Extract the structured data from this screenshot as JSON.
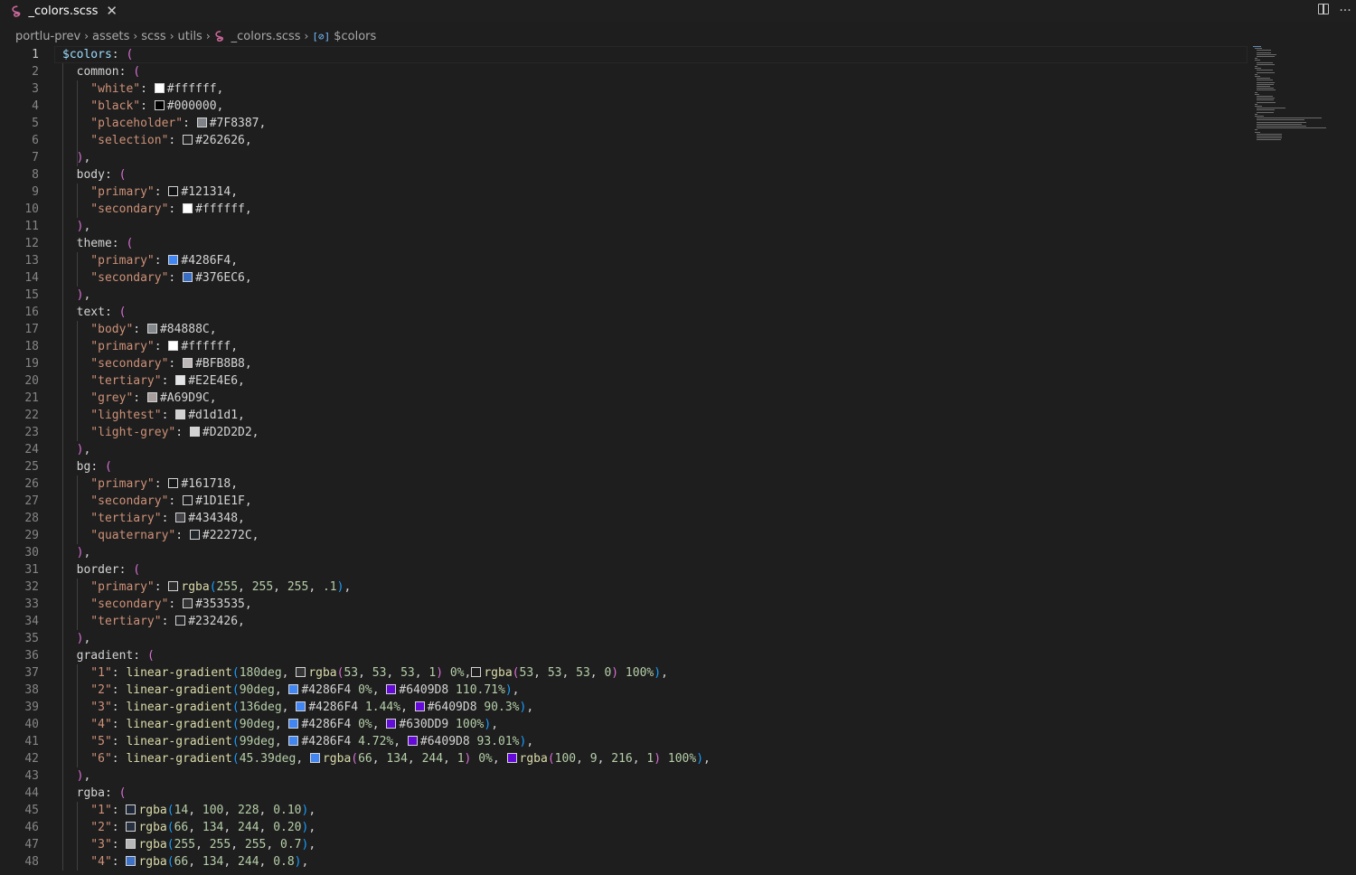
{
  "tab": {
    "title": "_colors.scss",
    "close": "✕"
  },
  "top_actions": {
    "more": "···"
  },
  "breadcrumb": [
    "portlu-prev",
    "assets",
    "scss",
    "utils",
    "_colors.scss",
    "$colors"
  ],
  "breadcrumb_sep": "›",
  "symbol_glyph": "[⊘]",
  "current_line": 1,
  "lines": [
    [
      {
        "t": "$colors",
        "c": "var"
      },
      {
        "t": ": ",
        "c": "p"
      },
      {
        "t": "(",
        "c": "brace"
      }
    ],
    [
      {
        "t": "  common",
        "c": "key"
      },
      {
        "t": ": ",
        "c": "p"
      },
      {
        "t": "(",
        "c": "brace"
      }
    ],
    [
      {
        "t": "    \"white\"",
        "c": "str"
      },
      {
        "t": ": ",
        "c": "p"
      },
      {
        "sw": "#ffffff"
      },
      {
        "t": "#ffffff,",
        "c": "p"
      }
    ],
    [
      {
        "t": "    \"black\"",
        "c": "str"
      },
      {
        "t": ": ",
        "c": "p"
      },
      {
        "sw": "#000000"
      },
      {
        "t": "#000000,",
        "c": "p"
      }
    ],
    [
      {
        "t": "    \"placeholder\"",
        "c": "str"
      },
      {
        "t": ": ",
        "c": "p"
      },
      {
        "sw": "#7F8387"
      },
      {
        "t": "#7F8387,",
        "c": "p"
      }
    ],
    [
      {
        "t": "    \"selection\"",
        "c": "str"
      },
      {
        "t": ": ",
        "c": "p"
      },
      {
        "sw": "#262626"
      },
      {
        "t": "#262626,",
        "c": "p"
      }
    ],
    [
      {
        "t": "  ",
        "c": "p"
      },
      {
        "t": ")",
        "c": "brace"
      },
      {
        "t": ",",
        "c": "p"
      }
    ],
    [
      {
        "t": "  body",
        "c": "key"
      },
      {
        "t": ": ",
        "c": "p"
      },
      {
        "t": "(",
        "c": "brace"
      }
    ],
    [
      {
        "t": "    \"primary\"",
        "c": "str"
      },
      {
        "t": ": ",
        "c": "p"
      },
      {
        "sw": "#121314"
      },
      {
        "t": "#121314,",
        "c": "p"
      }
    ],
    [
      {
        "t": "    \"secondary\"",
        "c": "str"
      },
      {
        "t": ": ",
        "c": "p"
      },
      {
        "sw": "#ffffff"
      },
      {
        "t": "#ffffff,",
        "c": "p"
      }
    ],
    [
      {
        "t": "  ",
        "c": "p"
      },
      {
        "t": ")",
        "c": "brace"
      },
      {
        "t": ",",
        "c": "p"
      }
    ],
    [
      {
        "t": "  theme",
        "c": "key"
      },
      {
        "t": ": ",
        "c": "p"
      },
      {
        "t": "(",
        "c": "brace"
      }
    ],
    [
      {
        "t": "    \"primary\"",
        "c": "str"
      },
      {
        "t": ": ",
        "c": "p"
      },
      {
        "sw": "#4286F4"
      },
      {
        "t": "#4286F4,",
        "c": "p"
      }
    ],
    [
      {
        "t": "    \"secondary\"",
        "c": "str"
      },
      {
        "t": ": ",
        "c": "p"
      },
      {
        "sw": "#376EC6"
      },
      {
        "t": "#376EC6,",
        "c": "p"
      }
    ],
    [
      {
        "t": "  ",
        "c": "p"
      },
      {
        "t": ")",
        "c": "brace"
      },
      {
        "t": ",",
        "c": "p"
      }
    ],
    [
      {
        "t": "  text",
        "c": "key"
      },
      {
        "t": ": ",
        "c": "p"
      },
      {
        "t": "(",
        "c": "brace"
      }
    ],
    [
      {
        "t": "    \"body\"",
        "c": "str"
      },
      {
        "t": ": ",
        "c": "p"
      },
      {
        "sw": "#84888C"
      },
      {
        "t": "#84888C,",
        "c": "p"
      }
    ],
    [
      {
        "t": "    \"primary\"",
        "c": "str"
      },
      {
        "t": ": ",
        "c": "p"
      },
      {
        "sw": "#ffffff"
      },
      {
        "t": "#ffffff,",
        "c": "p"
      }
    ],
    [
      {
        "t": "    \"secondary\"",
        "c": "str"
      },
      {
        "t": ": ",
        "c": "p"
      },
      {
        "sw": "#BFB8B8"
      },
      {
        "t": "#BFB8B8,",
        "c": "p"
      }
    ],
    [
      {
        "t": "    \"tertiary\"",
        "c": "str"
      },
      {
        "t": ": ",
        "c": "p"
      },
      {
        "sw": "#E2E4E6"
      },
      {
        "t": "#E2E4E6,",
        "c": "p"
      }
    ],
    [
      {
        "t": "    \"grey\"",
        "c": "str"
      },
      {
        "t": ": ",
        "c": "p"
      },
      {
        "sw": "#A69D9C"
      },
      {
        "t": "#A69D9C,",
        "c": "p"
      }
    ],
    [
      {
        "t": "    \"lightest\"",
        "c": "str"
      },
      {
        "t": ": ",
        "c": "p"
      },
      {
        "sw": "#d1d1d1"
      },
      {
        "t": "#d1d1d1,",
        "c": "p"
      }
    ],
    [
      {
        "t": "    \"light-grey\"",
        "c": "str"
      },
      {
        "t": ": ",
        "c": "p"
      },
      {
        "sw": "#D2D2D2"
      },
      {
        "t": "#D2D2D2,",
        "c": "p"
      }
    ],
    [
      {
        "t": "  ",
        "c": "p"
      },
      {
        "t": ")",
        "c": "brace"
      },
      {
        "t": ",",
        "c": "p"
      }
    ],
    [
      {
        "t": "  bg",
        "c": "key"
      },
      {
        "t": ": ",
        "c": "p"
      },
      {
        "t": "(",
        "c": "brace"
      }
    ],
    [
      {
        "t": "    \"primary\"",
        "c": "str"
      },
      {
        "t": ": ",
        "c": "p"
      },
      {
        "sw": "#161718"
      },
      {
        "t": "#161718,",
        "c": "p"
      }
    ],
    [
      {
        "t": "    \"secondary\"",
        "c": "str"
      },
      {
        "t": ": ",
        "c": "p"
      },
      {
        "sw": "#1D1E1F"
      },
      {
        "t": "#1D1E1F,",
        "c": "p"
      }
    ],
    [
      {
        "t": "    \"tertiary\"",
        "c": "str"
      },
      {
        "t": ": ",
        "c": "p"
      },
      {
        "sw": "#434348"
      },
      {
        "t": "#434348,",
        "c": "p"
      }
    ],
    [
      {
        "t": "    \"quaternary\"",
        "c": "str"
      },
      {
        "t": ": ",
        "c": "p"
      },
      {
        "sw": "#22272C"
      },
      {
        "t": "#22272C,",
        "c": "p"
      }
    ],
    [
      {
        "t": "  ",
        "c": "p"
      },
      {
        "t": ")",
        "c": "brace"
      },
      {
        "t": ",",
        "c": "p"
      }
    ],
    [
      {
        "t": "  border",
        "c": "key"
      },
      {
        "t": ": ",
        "c": "p"
      },
      {
        "t": "(",
        "c": "brace"
      }
    ],
    [
      {
        "t": "    \"primary\"",
        "c": "str"
      },
      {
        "t": ": ",
        "c": "p"
      },
      {
        "sw": "#2b2b2b"
      },
      {
        "t": "rgba",
        "c": "fn"
      },
      {
        "t": "(",
        "c": "paren"
      },
      {
        "t": "255",
        "c": "num"
      },
      {
        "t": ", ",
        "c": "p"
      },
      {
        "t": "255",
        "c": "num"
      },
      {
        "t": ", ",
        "c": "p"
      },
      {
        "t": "255",
        "c": "num"
      },
      {
        "t": ", ",
        "c": "p"
      },
      {
        "t": ".1",
        "c": "num"
      },
      {
        "t": ")",
        "c": "paren"
      },
      {
        "t": ",",
        "c": "p"
      }
    ],
    [
      {
        "t": "    \"secondary\"",
        "c": "str"
      },
      {
        "t": ": ",
        "c": "p"
      },
      {
        "sw": "#353535"
      },
      {
        "t": "#353535,",
        "c": "p"
      }
    ],
    [
      {
        "t": "    \"tertiary\"",
        "c": "str"
      },
      {
        "t": ": ",
        "c": "p"
      },
      {
        "sw": "#232426"
      },
      {
        "t": "#232426,",
        "c": "p"
      }
    ],
    [
      {
        "t": "  ",
        "c": "p"
      },
      {
        "t": ")",
        "c": "brace"
      },
      {
        "t": ",",
        "c": "p"
      }
    ],
    [
      {
        "t": "  gradient",
        "c": "key"
      },
      {
        "t": ": ",
        "c": "p"
      },
      {
        "t": "(",
        "c": "brace"
      }
    ],
    [
      {
        "t": "    \"1\"",
        "c": "str"
      },
      {
        "t": ": ",
        "c": "p"
      },
      {
        "t": "linear-gradient",
        "c": "fn"
      },
      {
        "t": "(",
        "c": "paren"
      },
      {
        "t": "180deg",
        "c": "num"
      },
      {
        "t": ", ",
        "c": "p"
      },
      {
        "sw": "#353535"
      },
      {
        "t": "rgba",
        "c": "fn"
      },
      {
        "t": "(",
        "c": "brace"
      },
      {
        "t": "53",
        "c": "num"
      },
      {
        "t": ", ",
        "c": "p"
      },
      {
        "t": "53",
        "c": "num"
      },
      {
        "t": ", ",
        "c": "p"
      },
      {
        "t": "53",
        "c": "num"
      },
      {
        "t": ", ",
        "c": "p"
      },
      {
        "t": "1",
        "c": "num"
      },
      {
        "t": ")",
        "c": "brace"
      },
      {
        "t": " ",
        "c": "p"
      },
      {
        "t": "0%",
        "c": "num"
      },
      {
        "t": ",",
        "c": "p"
      },
      {
        "sw": "#1e1e1e"
      },
      {
        "t": "rgba",
        "c": "fn"
      },
      {
        "t": "(",
        "c": "brace"
      },
      {
        "t": "53",
        "c": "num"
      },
      {
        "t": ", ",
        "c": "p"
      },
      {
        "t": "53",
        "c": "num"
      },
      {
        "t": ", ",
        "c": "p"
      },
      {
        "t": "53",
        "c": "num"
      },
      {
        "t": ", ",
        "c": "p"
      },
      {
        "t": "0",
        "c": "num"
      },
      {
        "t": ")",
        "c": "brace"
      },
      {
        "t": " ",
        "c": "p"
      },
      {
        "t": "100%",
        "c": "num"
      },
      {
        "t": ")",
        "c": "paren"
      },
      {
        "t": ",",
        "c": "p"
      }
    ],
    [
      {
        "t": "    \"2\"",
        "c": "str"
      },
      {
        "t": ": ",
        "c": "p"
      },
      {
        "t": "linear-gradient",
        "c": "fn"
      },
      {
        "t": "(",
        "c": "paren"
      },
      {
        "t": "90deg",
        "c": "num"
      },
      {
        "t": ", ",
        "c": "p"
      },
      {
        "sw": "#4286F4"
      },
      {
        "t": "#4286F4 ",
        "c": "p"
      },
      {
        "t": "0%",
        "c": "num"
      },
      {
        "t": ", ",
        "c": "p"
      },
      {
        "sw": "#6409D8"
      },
      {
        "t": "#6409D8 ",
        "c": "p"
      },
      {
        "t": "110.71%",
        "c": "num"
      },
      {
        "t": ")",
        "c": "paren"
      },
      {
        "t": ",",
        "c": "p"
      }
    ],
    [
      {
        "t": "    \"3\"",
        "c": "str"
      },
      {
        "t": ": ",
        "c": "p"
      },
      {
        "t": "linear-gradient",
        "c": "fn"
      },
      {
        "t": "(",
        "c": "paren"
      },
      {
        "t": "136deg",
        "c": "num"
      },
      {
        "t": ", ",
        "c": "p"
      },
      {
        "sw": "#4286F4"
      },
      {
        "t": "#4286F4 ",
        "c": "p"
      },
      {
        "t": "1.44%",
        "c": "num"
      },
      {
        "t": ", ",
        "c": "p"
      },
      {
        "sw": "#6409D8"
      },
      {
        "t": "#6409D8 ",
        "c": "p"
      },
      {
        "t": "90.3%",
        "c": "num"
      },
      {
        "t": ")",
        "c": "paren"
      },
      {
        "t": ",",
        "c": "p"
      }
    ],
    [
      {
        "t": "    \"4\"",
        "c": "str"
      },
      {
        "t": ": ",
        "c": "p"
      },
      {
        "t": "linear-gradient",
        "c": "fn"
      },
      {
        "t": "(",
        "c": "paren"
      },
      {
        "t": "90deg",
        "c": "num"
      },
      {
        "t": ", ",
        "c": "p"
      },
      {
        "sw": "#4286F4"
      },
      {
        "t": "#4286F4 ",
        "c": "p"
      },
      {
        "t": "0%",
        "c": "num"
      },
      {
        "t": ", ",
        "c": "p"
      },
      {
        "sw": "#630DD9"
      },
      {
        "t": "#630DD9 ",
        "c": "p"
      },
      {
        "t": "100%",
        "c": "num"
      },
      {
        "t": ")",
        "c": "paren"
      },
      {
        "t": ",",
        "c": "p"
      }
    ],
    [
      {
        "t": "    \"5\"",
        "c": "str"
      },
      {
        "t": ": ",
        "c": "p"
      },
      {
        "t": "linear-gradient",
        "c": "fn"
      },
      {
        "t": "(",
        "c": "paren"
      },
      {
        "t": "99deg",
        "c": "num"
      },
      {
        "t": ", ",
        "c": "p"
      },
      {
        "sw": "#4286F4"
      },
      {
        "t": "#4286F4 ",
        "c": "p"
      },
      {
        "t": "4.72%",
        "c": "num"
      },
      {
        "t": ", ",
        "c": "p"
      },
      {
        "sw": "#6409D8"
      },
      {
        "t": "#6409D8 ",
        "c": "p"
      },
      {
        "t": "93.01%",
        "c": "num"
      },
      {
        "t": ")",
        "c": "paren"
      },
      {
        "t": ",",
        "c": "p"
      }
    ],
    [
      {
        "t": "    \"6\"",
        "c": "str"
      },
      {
        "t": ": ",
        "c": "p"
      },
      {
        "t": "linear-gradient",
        "c": "fn"
      },
      {
        "t": "(",
        "c": "paren"
      },
      {
        "t": "45.39deg",
        "c": "num"
      },
      {
        "t": ", ",
        "c": "p"
      },
      {
        "sw": "#4286F4"
      },
      {
        "t": "rgba",
        "c": "fn"
      },
      {
        "t": "(",
        "c": "brace"
      },
      {
        "t": "66",
        "c": "num"
      },
      {
        "t": ", ",
        "c": "p"
      },
      {
        "t": "134",
        "c": "num"
      },
      {
        "t": ", ",
        "c": "p"
      },
      {
        "t": "244",
        "c": "num"
      },
      {
        "t": ", ",
        "c": "p"
      },
      {
        "t": "1",
        "c": "num"
      },
      {
        "t": ")",
        "c": "brace"
      },
      {
        "t": " ",
        "c": "p"
      },
      {
        "t": "0%",
        "c": "num"
      },
      {
        "t": ", ",
        "c": "p"
      },
      {
        "sw": "#6409D8"
      },
      {
        "t": "rgba",
        "c": "fn"
      },
      {
        "t": "(",
        "c": "brace"
      },
      {
        "t": "100",
        "c": "num"
      },
      {
        "t": ", ",
        "c": "p"
      },
      {
        "t": "9",
        "c": "num"
      },
      {
        "t": ", ",
        "c": "p"
      },
      {
        "t": "216",
        "c": "num"
      },
      {
        "t": ", ",
        "c": "p"
      },
      {
        "t": "1",
        "c": "num"
      },
      {
        "t": ")",
        "c": "brace"
      },
      {
        "t": " ",
        "c": "p"
      },
      {
        "t": "100%",
        "c": "num"
      },
      {
        "t": ")",
        "c": "paren"
      },
      {
        "t": ",",
        "c": "p"
      }
    ],
    [
      {
        "t": "  ",
        "c": "p"
      },
      {
        "t": ")",
        "c": "brace"
      },
      {
        "t": ",",
        "c": "p"
      }
    ],
    [
      {
        "t": "  rgba",
        "c": "key"
      },
      {
        "t": ": ",
        "c": "p"
      },
      {
        "t": "(",
        "c": "brace"
      }
    ],
    [
      {
        "t": "    \"1\"",
        "c": "str"
      },
      {
        "t": ": ",
        "c": "p"
      },
      {
        "sw": "#1e2838"
      },
      {
        "t": "rgba",
        "c": "fn"
      },
      {
        "t": "(",
        "c": "paren"
      },
      {
        "t": "14",
        "c": "num"
      },
      {
        "t": ", ",
        "c": "p"
      },
      {
        "t": "100",
        "c": "num"
      },
      {
        "t": ", ",
        "c": "p"
      },
      {
        "t": "228",
        "c": "num"
      },
      {
        "t": ", ",
        "c": "p"
      },
      {
        "t": "0.10",
        "c": "num"
      },
      {
        "t": ")",
        "c": "paren"
      },
      {
        "t": ",",
        "c": "p"
      }
    ],
    [
      {
        "t": "    \"2\"",
        "c": "str"
      },
      {
        "t": ": ",
        "c": "p"
      },
      {
        "sw": "#28313f"
      },
      {
        "t": "rgba",
        "c": "fn"
      },
      {
        "t": "(",
        "c": "paren"
      },
      {
        "t": "66",
        "c": "num"
      },
      {
        "t": ", ",
        "c": "p"
      },
      {
        "t": "134",
        "c": "num"
      },
      {
        "t": ", ",
        "c": "p"
      },
      {
        "t": "244",
        "c": "num"
      },
      {
        "t": ", ",
        "c": "p"
      },
      {
        "t": "0.20",
        "c": "num"
      },
      {
        "t": ")",
        "c": "paren"
      },
      {
        "t": ",",
        "c": "p"
      }
    ],
    [
      {
        "t": "    \"3\"",
        "c": "str"
      },
      {
        "t": ": ",
        "c": "p"
      },
      {
        "sw": "#b7b7b7"
      },
      {
        "t": "rgba",
        "c": "fn"
      },
      {
        "t": "(",
        "c": "paren"
      },
      {
        "t": "255",
        "c": "num"
      },
      {
        "t": ", ",
        "c": "p"
      },
      {
        "t": "255",
        "c": "num"
      },
      {
        "t": ", ",
        "c": "p"
      },
      {
        "t": "255",
        "c": "num"
      },
      {
        "t": ", ",
        "c": "p"
      },
      {
        "t": "0.7",
        "c": "num"
      },
      {
        "t": ")",
        "c": "paren"
      },
      {
        "t": ",",
        "c": "p"
      }
    ],
    [
      {
        "t": "    \"4\"",
        "c": "str"
      },
      {
        "t": ": ",
        "c": "p"
      },
      {
        "sw": "#3e72c8"
      },
      {
        "t": "rgba",
        "c": "fn"
      },
      {
        "t": "(",
        "c": "paren"
      },
      {
        "t": "66",
        "c": "num"
      },
      {
        "t": ", ",
        "c": "p"
      },
      {
        "t": "134",
        "c": "num"
      },
      {
        "t": ", ",
        "c": "p"
      },
      {
        "t": "244",
        "c": "num"
      },
      {
        "t": ", ",
        "c": "p"
      },
      {
        "t": "0.8",
        "c": "num"
      },
      {
        "t": ")",
        "c": "paren"
      },
      {
        "t": ",",
        "c": "p"
      }
    ]
  ]
}
